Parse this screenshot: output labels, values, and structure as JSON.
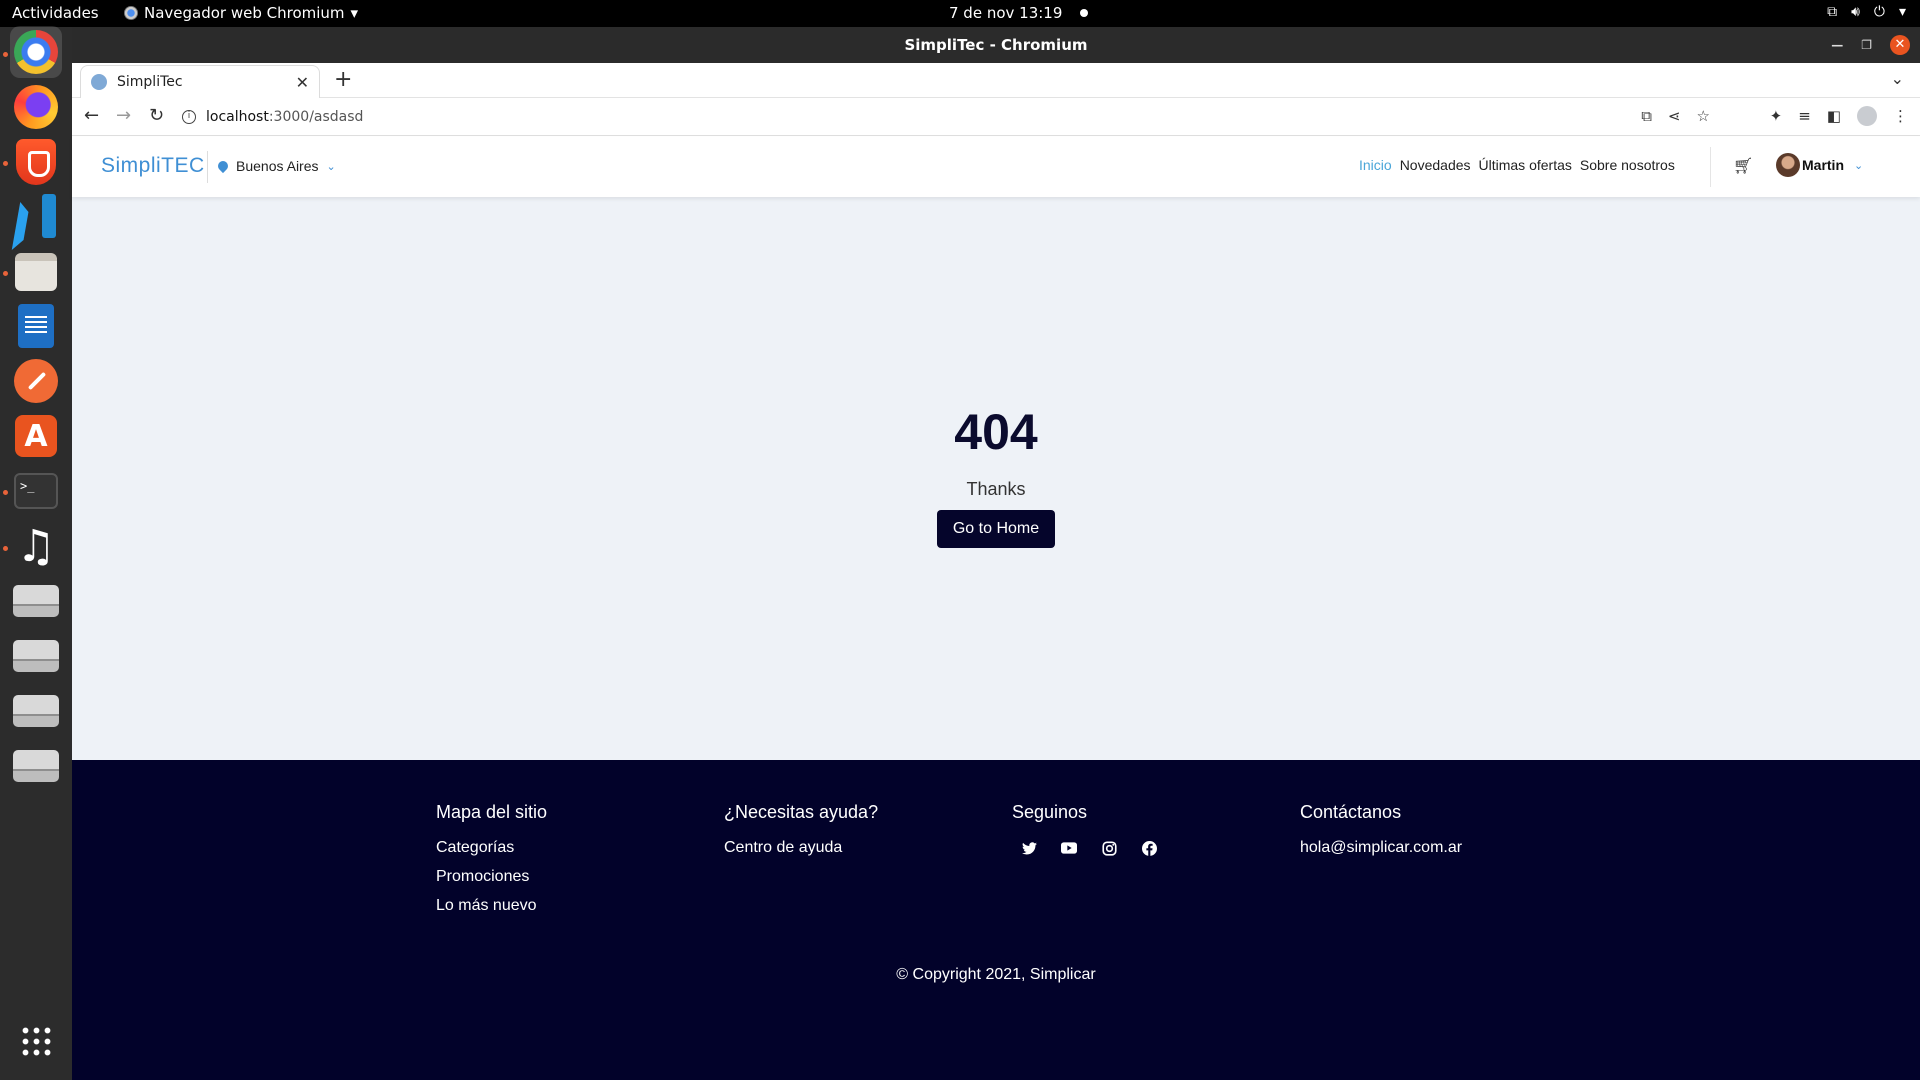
{
  "system": {
    "activities": "Actividades",
    "app_menu": "Navegador web Chromium",
    "clock": "7 de nov  13:19"
  },
  "window": {
    "title": "SimpliTec - Chromium"
  },
  "tab": {
    "title": "SimpliTec"
  },
  "omnibox": {
    "host": "localhost",
    "path": ":3000/asdasd"
  },
  "site": {
    "logo": "SimpliTEC",
    "location": "Buenos Aires",
    "nav": {
      "inicio": "Inicio",
      "novedades": "Novedades",
      "ofertas": "Últimas ofertas",
      "nosotros": "Sobre nosotros"
    },
    "user": "Martin"
  },
  "error": {
    "code": "404",
    "message": "Thanks",
    "button": "Go to Home"
  },
  "footer": {
    "sitemap": {
      "title": "Mapa del sitio",
      "links": [
        "Categorías",
        "Promociones",
        "Lo más nuevo"
      ]
    },
    "help": {
      "title": "¿Necesitas ayuda?",
      "links": [
        "Centro de ayuda"
      ]
    },
    "follow": {
      "title": "Seguinos",
      "icons": [
        "twitter-icon",
        "youtube-icon",
        "instagram-icon",
        "facebook-icon"
      ]
    },
    "contact": {
      "title": "Contáctanos",
      "email": "hola@simplicar.com.ar"
    },
    "copyright": "© Copyright 2021, Simplicar"
  },
  "colors": {
    "accent": "#3f8fd4",
    "footer_bg": "#02022a",
    "button_bg": "#05052b",
    "page_bg": "#eef2f7"
  }
}
